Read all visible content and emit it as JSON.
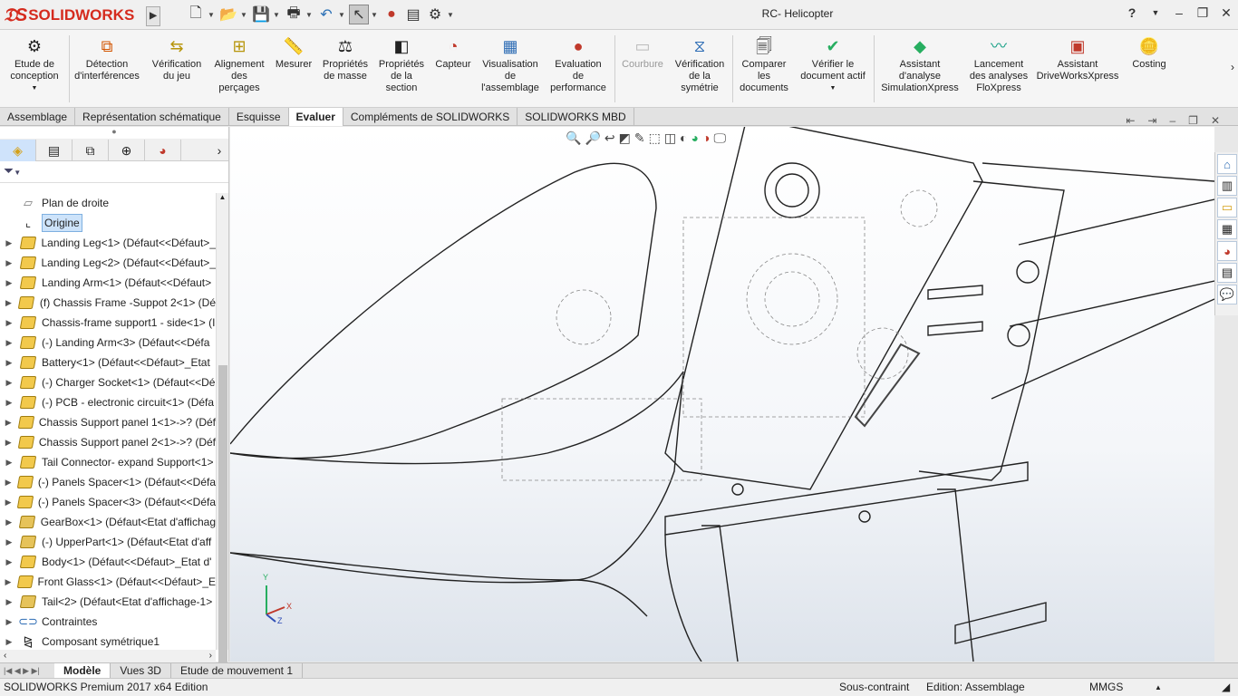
{
  "app": {
    "brand": "SOLIDWORKS",
    "doc_title": "RC- Helicopter",
    "help": "?"
  },
  "ribbon": {
    "buttons": [
      {
        "label": "Etude de\nconception",
        "icon": "design-study-icon"
      },
      {
        "label": "Détection\nd'interférences",
        "icon": "interference-icon"
      },
      {
        "label": "Vérification\ndu jeu",
        "icon": "clearance-icon"
      },
      {
        "label": "Alignement\ndes\nperçages",
        "icon": "hole-alignment-icon"
      },
      {
        "label": "Mesurer",
        "icon": "measure-icon"
      },
      {
        "label": "Propriétés\nde masse",
        "icon": "mass-properties-icon"
      },
      {
        "label": "Propriétés\nde la\nsection",
        "icon": "section-properties-icon"
      },
      {
        "label": "Capteur",
        "icon": "sensor-icon"
      },
      {
        "label": "Visualisation\nde\nl'assemblage",
        "icon": "assembly-visualization-icon"
      },
      {
        "label": "Evaluation\nde\nperformance",
        "icon": "performance-icon"
      },
      {
        "label": "Courbure",
        "icon": "curvature-icon"
      },
      {
        "label": "Vérification\nde la\nsymétrie",
        "icon": "symmetry-icon"
      },
      {
        "label": "Comparer\nles\ndocuments",
        "icon": "compare-icon"
      },
      {
        "label": "Vérifier le\ndocument actif",
        "icon": "check-icon"
      },
      {
        "label": "Assistant\nd'analyse\nSimulationXpress",
        "icon": "simulation-icon"
      },
      {
        "label": "Lancement\ndes analyses\nFloXpress",
        "icon": "floxpress-icon"
      },
      {
        "label": "Assistant\nDriveWorksXpress",
        "icon": "driveworks-icon"
      },
      {
        "label": "Costing",
        "icon": "costing-icon"
      }
    ]
  },
  "tabs": [
    "Assemblage",
    "Représentation schématique",
    "Esquisse",
    "Evaluer",
    "Compléments de SOLIDWORKS",
    "SOLIDWORKS MBD"
  ],
  "active_tab": "Evaluer",
  "tree": {
    "items": [
      {
        "label": "Plan de droite",
        "type": "plane"
      },
      {
        "label": "Origine",
        "type": "origin",
        "selected": true
      },
      {
        "label": "Landing Leg<1> (Défaut<<Défaut>_",
        "type": "part"
      },
      {
        "label": "Landing Leg<2> (Défaut<<Défaut>_",
        "type": "part"
      },
      {
        "label": "Landing Arm<1> (Défaut<<Défaut>",
        "type": "part"
      },
      {
        "label": "(f) Chassis Frame -Suppot 2<1> (Dé",
        "type": "part"
      },
      {
        "label": "Chassis-frame support1 - side<1> (I",
        "type": "part"
      },
      {
        "label": "(-) Landing Arm<3> (Défaut<<Défa",
        "type": "part"
      },
      {
        "label": "Battery<1> (Défaut<<Défaut>_Etat",
        "type": "part"
      },
      {
        "label": "(-) Charger Socket<1> (Défaut<<Dé",
        "type": "part"
      },
      {
        "label": "(-) PCB -  electronic circuit<1> (Défa",
        "type": "part"
      },
      {
        "label": "Chassis Support panel 1<1>->? (Déf",
        "type": "part"
      },
      {
        "label": "Chassis Support panel 2<1>->? (Déf",
        "type": "part"
      },
      {
        "label": "Tail Connector- expand Support<1>",
        "type": "part"
      },
      {
        "label": "(-) Panels Spacer<1> (Défaut<<Défa",
        "type": "part"
      },
      {
        "label": "(-) Panels Spacer<3> (Défaut<<Défa",
        "type": "part"
      },
      {
        "label": "GearBox<1> (Défaut<Etat d'affichag",
        "type": "asm"
      },
      {
        "label": "(-) UpperPart<1> (Défaut<Etat d'aff",
        "type": "asm"
      },
      {
        "label": "Body<1> (Défaut<<Défaut>_Etat d'",
        "type": "part"
      },
      {
        "label": "Front Glass<1> (Défaut<<Défaut>_E",
        "type": "part"
      },
      {
        "label": "Tail<2> (Défaut<Etat d'affichage-1>",
        "type": "asm"
      },
      {
        "label": "Contraintes",
        "type": "mates"
      },
      {
        "label": "Composant symétrique1",
        "type": "mirror"
      }
    ]
  },
  "bottom_tabs": [
    "Modèle",
    "Vues 3D",
    "Etude de mouvement 1"
  ],
  "active_bottom_tab": "Modèle",
  "status": {
    "edition": "SOLIDWORKS Premium 2017 x64 Edition",
    "constraint": "Sous-contraint",
    "mode": "Edition: Assemblage",
    "units": "MMGS",
    "units_arrow": "▲"
  },
  "triad": {
    "x": "X",
    "y": "Y",
    "z": "Z"
  }
}
